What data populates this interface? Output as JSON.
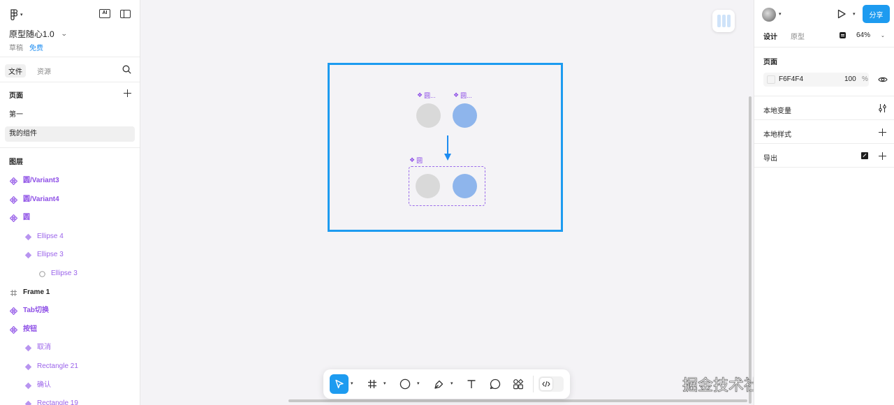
{
  "app": {
    "file_name": "原型随心1.0",
    "draft_label": "草稿",
    "plan_label": "免费",
    "ai_badge": "AI"
  },
  "left_panel": {
    "tabs": [
      {
        "label": "文件",
        "active": true
      },
      {
        "label": "资源",
        "active": false
      }
    ],
    "pages_title": "页面",
    "pages": [
      {
        "label": "第一",
        "selected": false
      },
      {
        "label": "我的组件",
        "selected": true
      }
    ],
    "layers_title": "图层",
    "layers": [
      {
        "label": "圆/Variant3",
        "kind": "component-set-child",
        "indent": 0
      },
      {
        "label": "圆/Variant4",
        "kind": "component-set-child",
        "indent": 0
      },
      {
        "label": "圆",
        "kind": "component",
        "indent": 0
      },
      {
        "label": "Ellipse 4",
        "kind": "instance-diamond",
        "indent": 1
      },
      {
        "label": "Ellipse 3",
        "kind": "instance-diamond",
        "indent": 1
      },
      {
        "label": "Ellipse 3",
        "kind": "ellipse",
        "indent": 2
      },
      {
        "label": "Frame 1",
        "kind": "frame",
        "indent": 0
      },
      {
        "label": "Tab切换",
        "kind": "component",
        "indent": 0
      },
      {
        "label": "按钮",
        "kind": "component",
        "indent": 0
      },
      {
        "label": "取消",
        "kind": "instance-diamond",
        "indent": 1
      },
      {
        "label": "Rectangle 21",
        "kind": "instance-diamond",
        "indent": 1
      },
      {
        "label": "确认",
        "kind": "instance-diamond",
        "indent": 1
      },
      {
        "label": "Rectangle 19",
        "kind": "instance-diamond",
        "indent": 1
      }
    ]
  },
  "canvas": {
    "labels": {
      "top_left": "圆...",
      "top_right": "圆...",
      "variant_set": "圆"
    },
    "colors": {
      "grey_circle": "#d9d9d9",
      "blue_circle": "#8eb5ec",
      "frame_border": "#1d9bf0",
      "component_purple": "#8d4ee6"
    },
    "watermark": "掘金技术社区 @ 我码玄黄"
  },
  "toolbar": {
    "tools": [
      {
        "name": "move-tool",
        "active": true
      },
      {
        "name": "frame-tool",
        "active": false
      },
      {
        "name": "ellipse-tool",
        "active": false
      },
      {
        "name": "pen-tool",
        "active": false
      },
      {
        "name": "text-tool",
        "active": false
      },
      {
        "name": "comment-tool",
        "active": false
      },
      {
        "name": "components-tool",
        "active": false
      },
      {
        "name": "dev-mode-toggle",
        "active": false
      }
    ]
  },
  "right_panel": {
    "share_label": "分享",
    "tabs": [
      {
        "label": "设计",
        "active": true
      },
      {
        "label": "原型",
        "active": false
      }
    ],
    "zoom": "64%",
    "page_section_title": "页面",
    "page_color_hex": "F6F4F4",
    "page_color_opacity": "100",
    "percent_sign": "%",
    "local_variables": "本地变量",
    "local_styles": "本地样式",
    "export": "导出"
  }
}
